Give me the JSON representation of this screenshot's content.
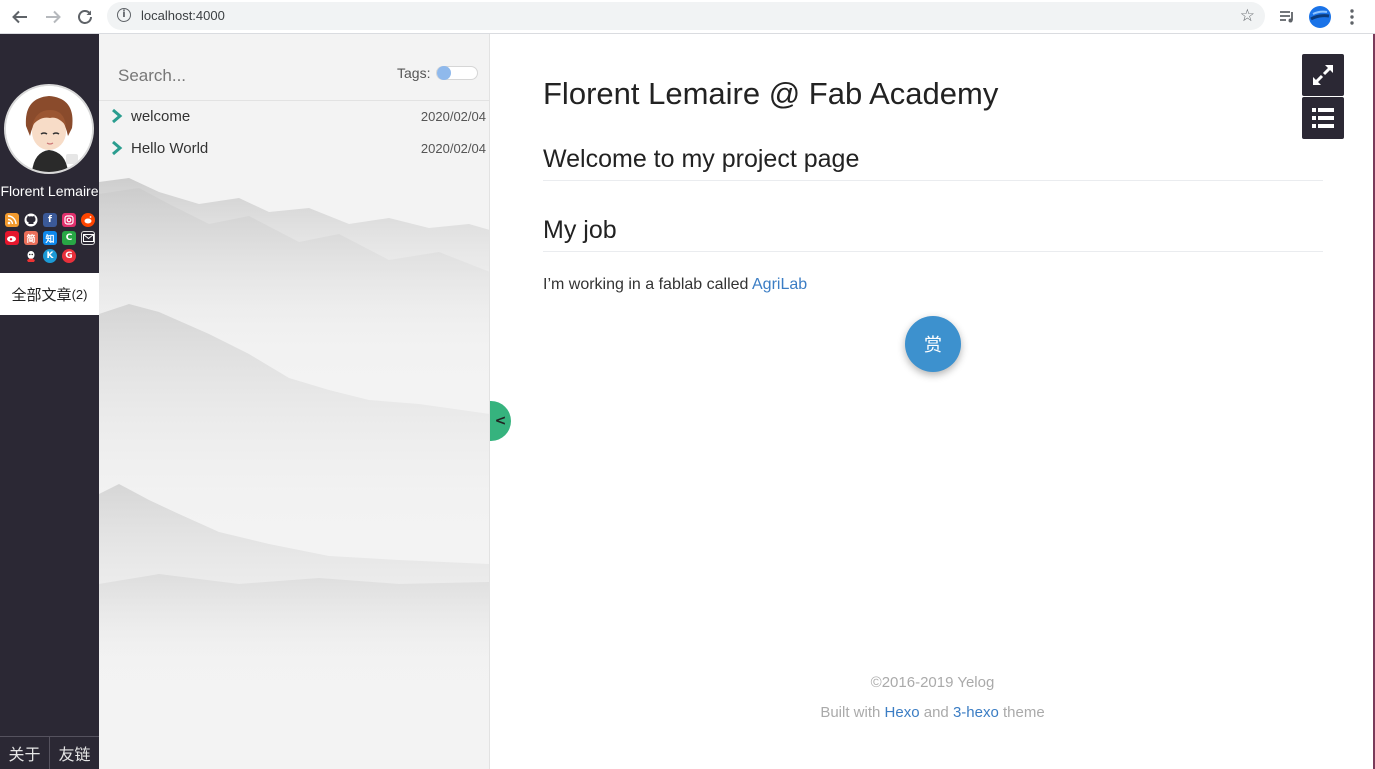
{
  "browser": {
    "url": "localhost:4000"
  },
  "sidebar": {
    "author_name": "Florent Lemaire",
    "social_icons": [
      "rss-icon",
      "github-icon",
      "facebook-icon",
      "instagram-icon",
      "reddit-icon",
      "weibo-icon",
      "jianshu-icon",
      "zhihu-icon",
      "csdn-icon",
      "email-icon",
      "qq-icon",
      "kaggle-icon",
      "segmentfault-icon"
    ],
    "all_posts_label": "全部文章",
    "all_posts_count": "(2)",
    "about_label": "关于",
    "links_label": "友链"
  },
  "panel": {
    "search_placeholder": "Search...",
    "tags_label": "Tags:",
    "posts": [
      {
        "title": "welcome",
        "date": "2020/02/04"
      },
      {
        "title": "Hello World",
        "date": "2020/02/04"
      }
    ],
    "collapse_label": "<"
  },
  "article": {
    "title": "Florent Lemaire @ Fab Academy",
    "section1": "Welcome to my project page",
    "section2": "My job",
    "paragraph_text": "I’m working in a fablab called ",
    "paragraph_link": "AgriLab",
    "reward_label": "赏"
  },
  "footer": {
    "copyright": "©2016-2019 Yelog",
    "built_prefix": "Built with ",
    "hexo_link": "Hexo",
    "and_text": " and ",
    "theme_link": "3-hexo",
    "theme_suffix": " theme"
  },
  "colors": {
    "sidebar_bg": "#2b2834",
    "accent_green": "#36b37e",
    "link_blue": "#3b7dc4",
    "reward_blue": "#3d91ce"
  }
}
